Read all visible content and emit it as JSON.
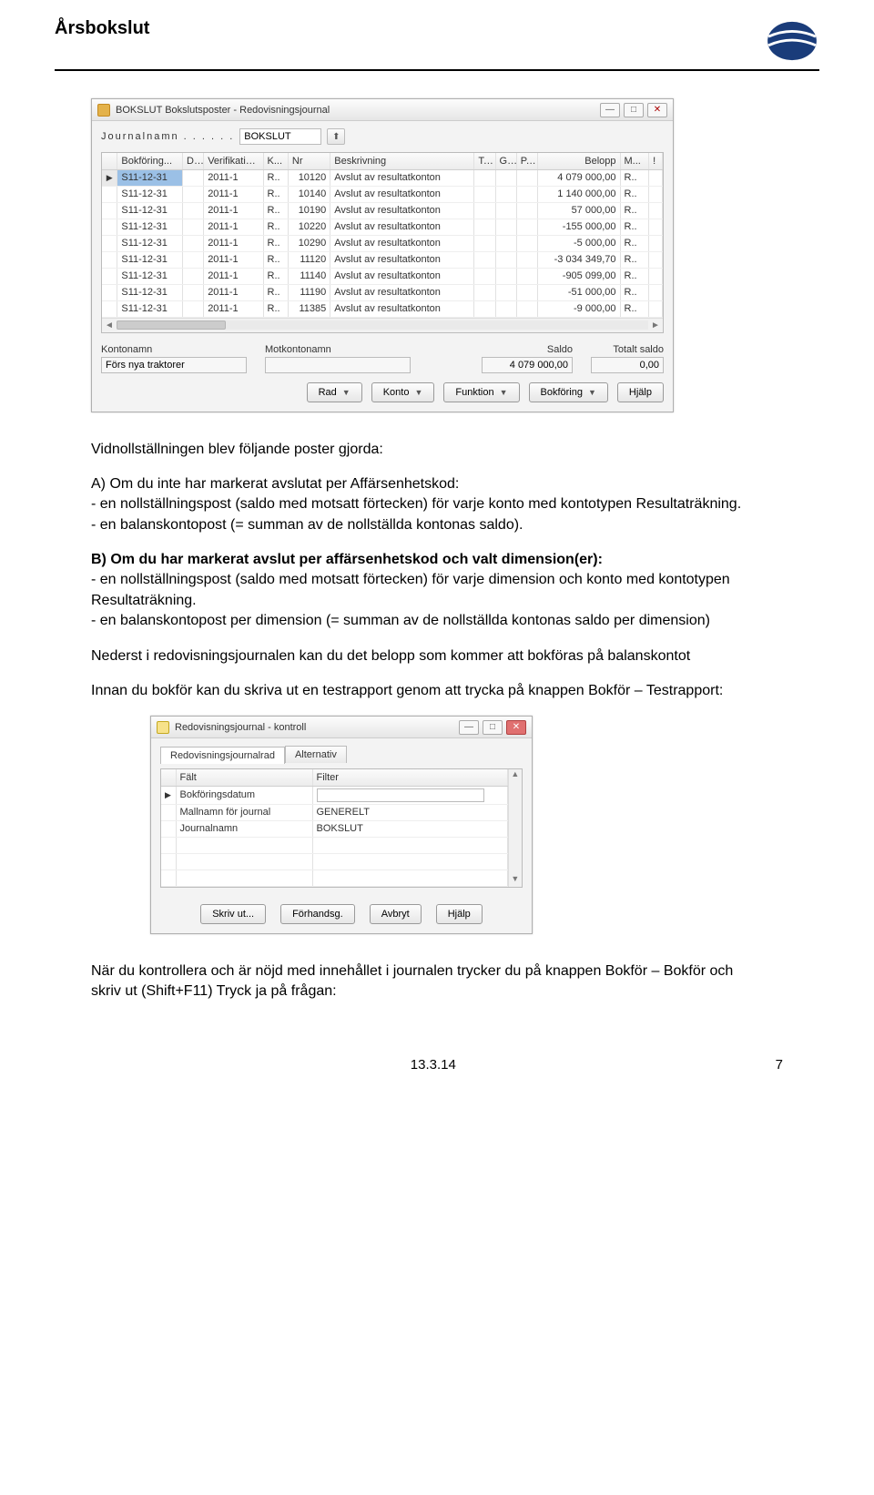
{
  "doc_title": "Årsbokslut",
  "logo_alt": "logo",
  "win1": {
    "title": "BOKSLUT Bokslutsposter - Redovisningsjournal",
    "journal_label": "Journalnamn . . . . . .",
    "journal_value": "BOKSLUT",
    "columns": {
      "bokforing": "Bokföring...",
      "d": "D...",
      "verifikatio": "Verifikatio...",
      "k": "K...",
      "nr": "Nr",
      "beskrivning": "Beskrivning",
      "t": "T...",
      "g": "G...",
      "p": "P...",
      "belopp": "Belopp",
      "m": "M...",
      "excl": "!"
    },
    "rows": [
      {
        "bok": "S11-12-31",
        "d": "",
        "ver": "2011-1",
        "k": "R..",
        "nr": "10120",
        "besk": "Avslut av resultatkonton",
        "belopp": "4 079 000,00",
        "m": "R.."
      },
      {
        "bok": "S11-12-31",
        "d": "",
        "ver": "2011-1",
        "k": "R..",
        "nr": "10140",
        "besk": "Avslut av resultatkonton",
        "belopp": "1 140 000,00",
        "m": "R.."
      },
      {
        "bok": "S11-12-31",
        "d": "",
        "ver": "2011-1",
        "k": "R..",
        "nr": "10190",
        "besk": "Avslut av resultatkonton",
        "belopp": "57 000,00",
        "m": "R.."
      },
      {
        "bok": "S11-12-31",
        "d": "",
        "ver": "2011-1",
        "k": "R..",
        "nr": "10220",
        "besk": "Avslut av resultatkonton",
        "belopp": "-155 000,00",
        "m": "R.."
      },
      {
        "bok": "S11-12-31",
        "d": "",
        "ver": "2011-1",
        "k": "R..",
        "nr": "10290",
        "besk": "Avslut av resultatkonton",
        "belopp": "-5 000,00",
        "m": "R.."
      },
      {
        "bok": "S11-12-31",
        "d": "",
        "ver": "2011-1",
        "k": "R..",
        "nr": "11120",
        "besk": "Avslut av resultatkonton",
        "belopp": "-3 034 349,70",
        "m": "R.."
      },
      {
        "bok": "S11-12-31",
        "d": "",
        "ver": "2011-1",
        "k": "R..",
        "nr": "11140",
        "besk": "Avslut av resultatkonton",
        "belopp": "-905 099,00",
        "m": "R.."
      },
      {
        "bok": "S11-12-31",
        "d": "",
        "ver": "2011-1",
        "k": "R..",
        "nr": "11190",
        "besk": "Avslut av resultatkonton",
        "belopp": "-51 000,00",
        "m": "R.."
      },
      {
        "bok": "S11-12-31",
        "d": "",
        "ver": "2011-1",
        "k": "R..",
        "nr": "11385",
        "besk": "Avslut av resultatkonton",
        "belopp": "-9 000,00",
        "m": "R.."
      }
    ],
    "summary": {
      "kontonamn_label": "Kontonamn",
      "kontonamn_value": "Förs nya traktorer",
      "motkontonamn_label": "Motkontonamn",
      "motkontonamn_value": "",
      "saldo_label": "Saldo",
      "saldo_value": "4 079 000,00",
      "totalt_label": "Totalt saldo",
      "totalt_value": "0,00"
    },
    "buttons": {
      "rad": "Rad",
      "konto": "Konto",
      "funktion": "Funktion",
      "bokforing": "Bokföring",
      "hjalp": "Hjälp"
    }
  },
  "prose": {
    "p1": "Vidnollställningen blev följande poster gjorda:",
    "p2a": "A) Om du inte har markerat avslutat per Affärsenhetskod:",
    "p2b": "- en nollställningspost (saldo med motsatt förtecken) för varje konto med kontotypen Resultaträkning.",
    "p2c": "- en balanskontopost (= summan av de nollställda kontonas saldo).",
    "p3a": "B) Om du har markerat avslut per affärsenhetskod och valt dimension(er):",
    "p3b": "- en nollställningspost (saldo med motsatt förtecken) för varje dimension och konto med kontotypen Resultaträkning.",
    "p3c": "- en balanskontopost per dimension (= summan av de nollställda kontonas saldo per dimension)",
    "p4": "Nederst i redovisningsjournalen kan du det belopp som kommer att bokföras på balanskontot",
    "p5": "Innan du bokför kan du skriva ut en testrapport genom att trycka på knappen Bokför – Testrapport:",
    "p6": "När du kontrollera och är nöjd med innehållet i journalen trycker du på knappen Bokför – Bokför och skriv ut (Shift+F11) Tryck ja på frågan:"
  },
  "win2": {
    "title": "Redovisningsjournal - kontroll",
    "tab1": "Redovisningsjournalrad",
    "tab2": "Alternativ",
    "col_falt": "Fält",
    "col_filter": "Filter",
    "rows": [
      {
        "falt": "Bokföringsdatum",
        "filter": ""
      },
      {
        "falt": "Mallnamn för journal",
        "filter": "GENERELT"
      },
      {
        "falt": "Journalnamn",
        "filter": "BOKSLUT"
      }
    ],
    "buttons": {
      "skrivut": "Skriv ut...",
      "forhandsg": "Förhandsg.",
      "avbryt": "Avbryt",
      "hjalp": "Hjälp"
    }
  },
  "footer": {
    "version": "13.3.14",
    "page": "7"
  }
}
